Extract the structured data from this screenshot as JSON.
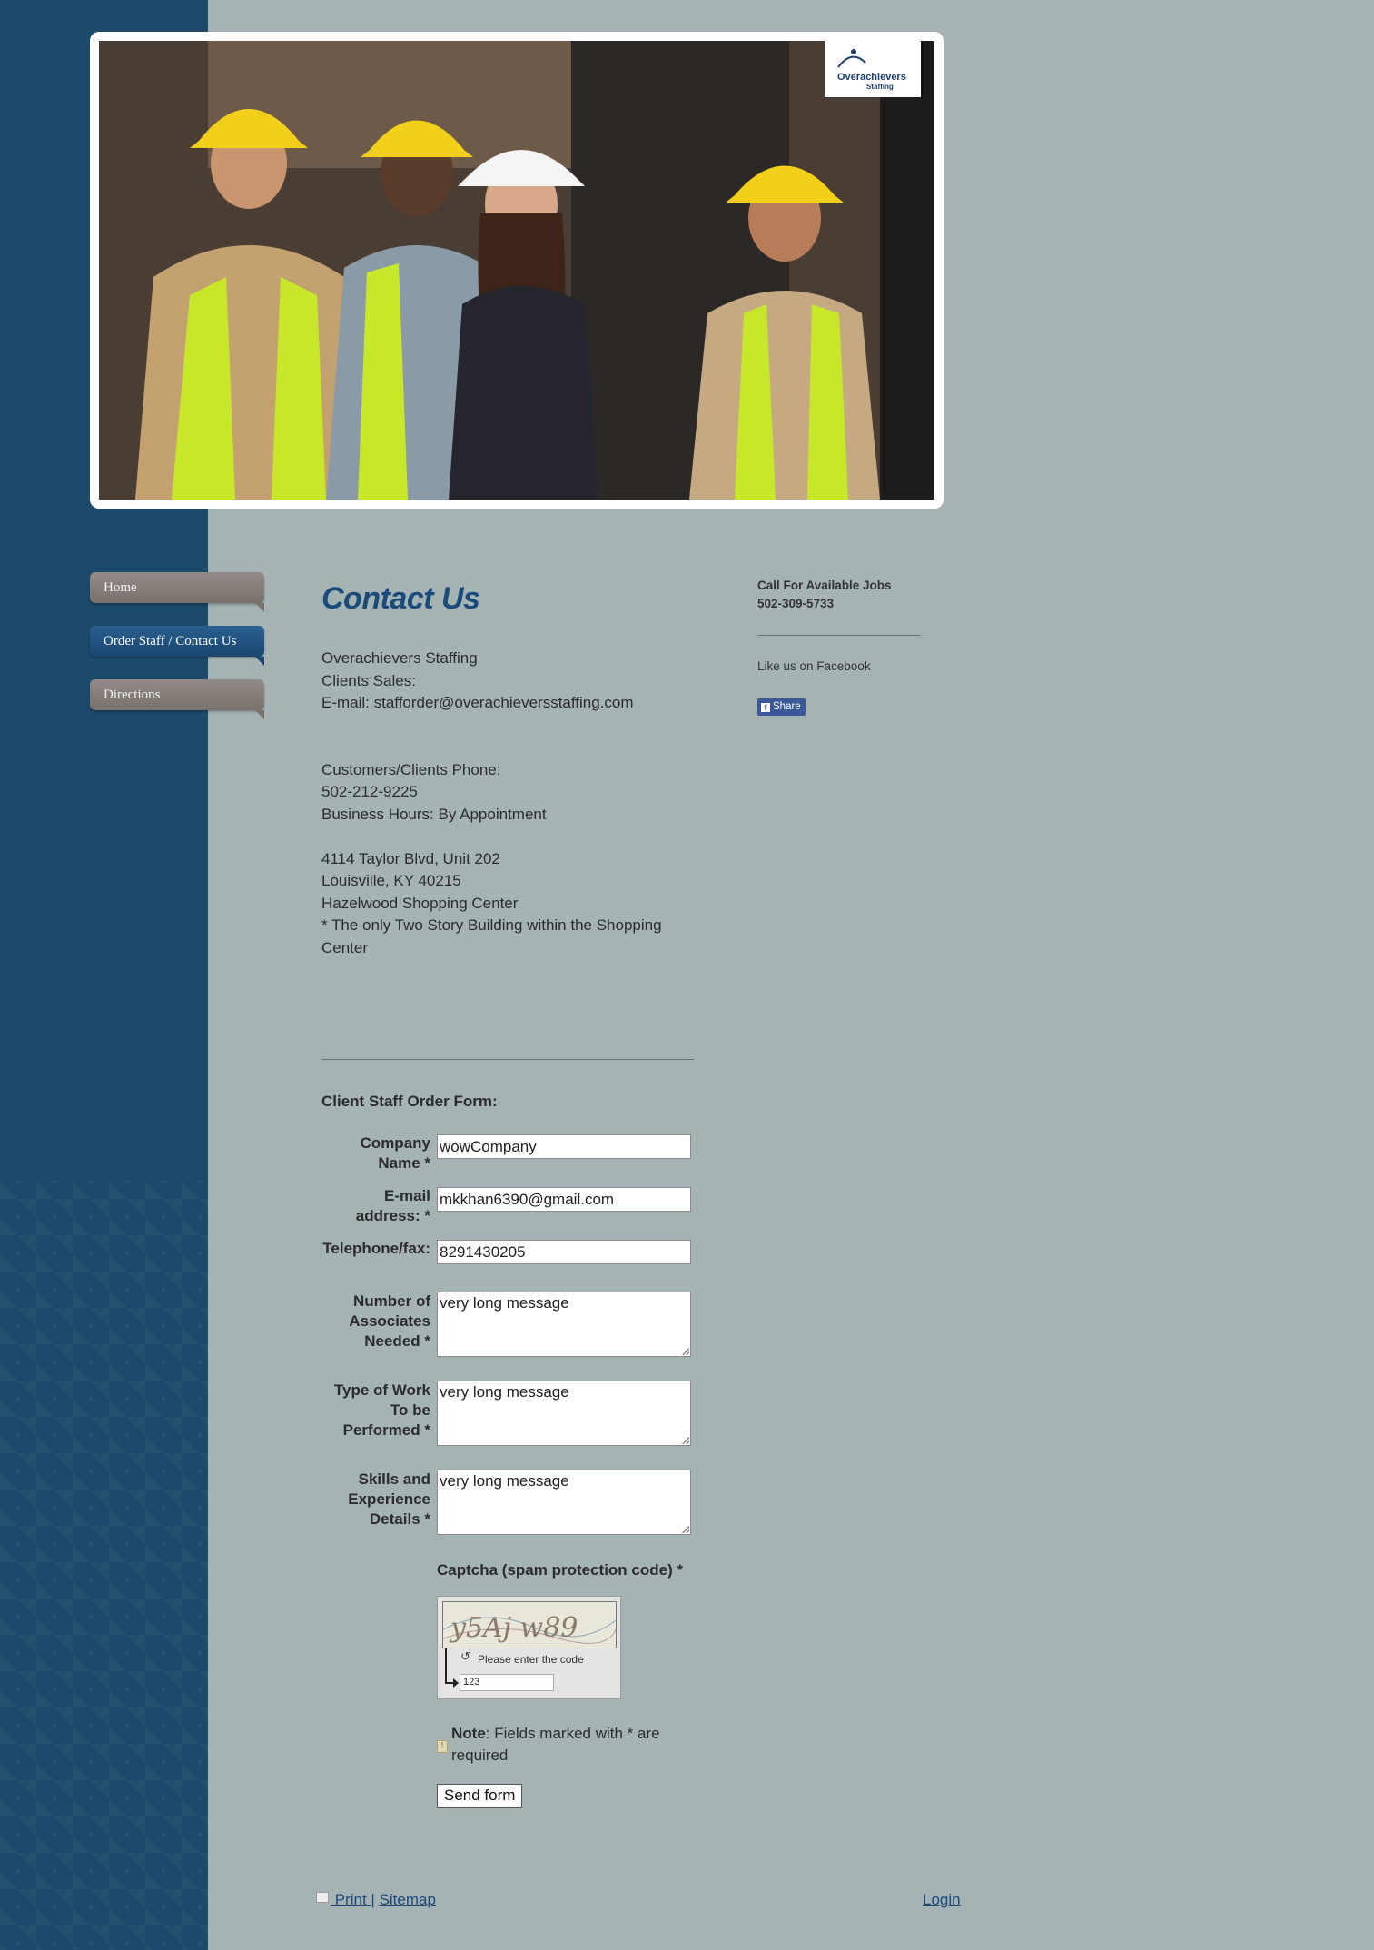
{
  "header": {
    "logo_text": "Overachievers",
    "logo_sub": "Staffing",
    "photo_alt": "Workers in hard hats and safety vests"
  },
  "nav": {
    "items": [
      {
        "label": "Home",
        "active": false
      },
      {
        "label": "Order Staff / Contact Us",
        "active": true
      },
      {
        "label": "Directions",
        "active": false
      }
    ]
  },
  "main": {
    "title": "Contact Us",
    "lines": [
      "Overachievers Staffing",
      "Clients Sales:",
      "E-mail: stafforder@overachieversstaffing.com",
      "",
      "",
      "Customers/Clients Phone:",
      "502-212-9225",
      "Business Hours: By Appointment",
      "",
      "4114 Taylor Blvd, Unit 202",
      "Louisville, KY 40215",
      "Hazelwood Shopping Center",
      "* The only Two Story Building within the Shopping Center"
    ]
  },
  "form": {
    "title": "Client Staff Order Form:",
    "company_label": "Company Name *",
    "company_value": "wowCompany",
    "email_label": "E-mail address: *",
    "email_value": "mkkhan6390@gmail.com",
    "phone_label": "Telephone/fax:",
    "phone_value": "8291430205",
    "associates_label": "Number of Associates Needed *",
    "associates_value": "very long message",
    "work_label": "Type of Work To be Performed *",
    "work_value": "very long message",
    "skills_label": "Skills and Experience Details *",
    "skills_value": "very long message",
    "captcha_label": "Captcha (spam protection code) *",
    "captcha_code": "y5Aj w89",
    "captcha_hint": "Please enter the code",
    "captcha_value": "123",
    "note_bold": "Note",
    "note_rest": ": Fields marked with * are required",
    "submit_label": "Send form"
  },
  "sidebar_right": {
    "jobs_heading": "Call For Available Jobs",
    "jobs_phone": "502-309-5733",
    "facebook_text": "Like us on Facebook",
    "share_label": "Share"
  },
  "footer": {
    "print_label": " Print ",
    "separator": "|",
    "sitemap_label": "Sitemap",
    "login_label": "Login"
  },
  "colors": {
    "page_bg": "#a5b3b5",
    "side_band": "#1d4a6b",
    "title_blue": "#1b4b7a",
    "nav_active": "#1b4670",
    "nav_inactive": "#7a716d",
    "facebook": "#3b5998"
  }
}
